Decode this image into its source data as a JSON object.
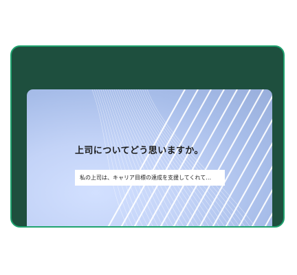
{
  "survey": {
    "question": "上司についてどう思いますか。",
    "answer_value": "私の上司は、キャリア目標の達成を支援してくれて…"
  },
  "colors": {
    "frame_background": "#1e4f3e",
    "frame_border": "#1fa36f",
    "card_gradient_light": "#d2e0ff",
    "card_gradient_dark": "#98aedb",
    "input_background": "#ffffff"
  }
}
